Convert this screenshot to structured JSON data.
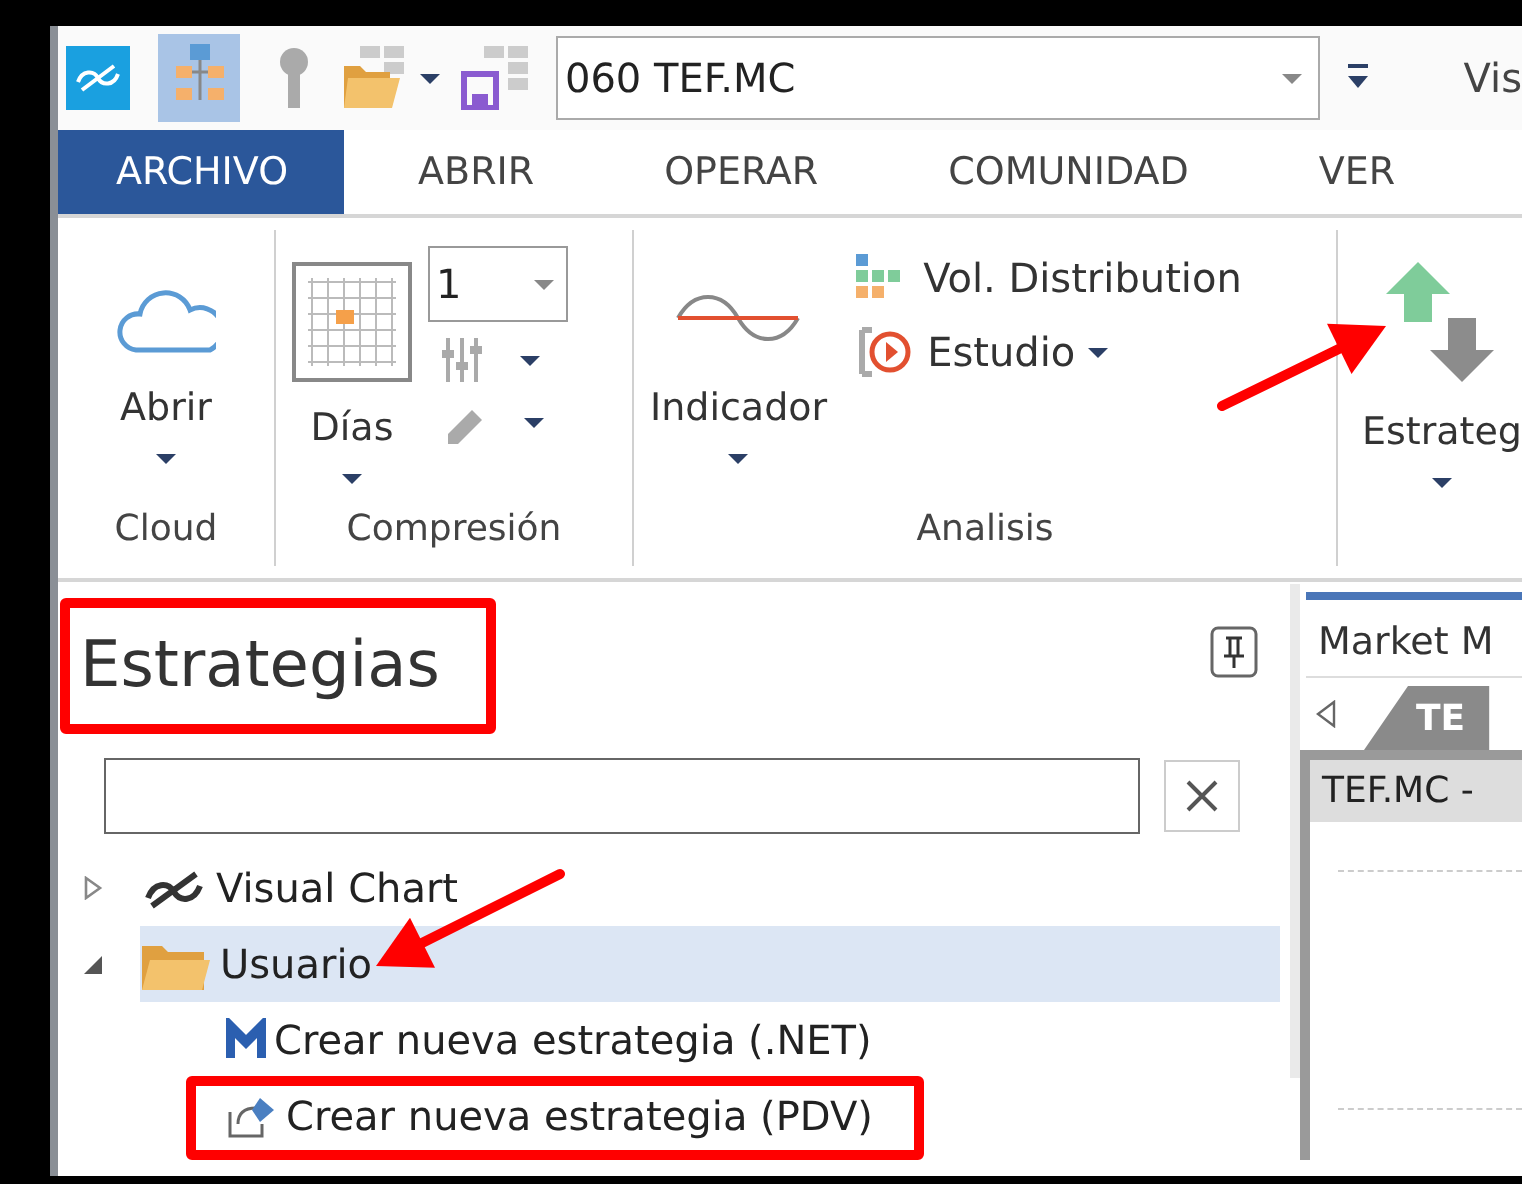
{
  "quick_access": {
    "symbol_field": {
      "value": "060 TEF.MC"
    },
    "app_title": "Vis"
  },
  "ribbon": {
    "tabs": [
      {
        "label": "ARCHIVO",
        "selected": true
      },
      {
        "label": "ABRIR",
        "selected": false
      },
      {
        "label": "OPERAR",
        "selected": false
      },
      {
        "label": "COMUNIDAD",
        "selected": false
      },
      {
        "label": "VER",
        "selected": false
      }
    ],
    "groups": [
      {
        "kind": "cloud",
        "label": "Cloud",
        "large_button": {
          "label": "Abrir"
        }
      },
      {
        "kind": "compression",
        "label": "Compresión",
        "large_button": {
          "label": "Días"
        },
        "spinner": {
          "value": "1"
        }
      },
      {
        "kind": "analysis",
        "label": "Analisis",
        "large_button": {
          "label": "Indicador"
        },
        "small_buttons": [
          {
            "label": "Vol. Distribution",
            "dropdown": false
          },
          {
            "label": "Estudio",
            "dropdown": true
          }
        ]
      },
      {
        "kind": "strategies",
        "large_button": {
          "label": "Estrateg",
          "arrow": true
        }
      }
    ]
  },
  "strategies_panel": {
    "title": "Estrategias",
    "title_highlighted": true,
    "tree": [
      {
        "kind": "logo",
        "label": "Visual Chart",
        "expanded": false,
        "selected": false
      },
      {
        "kind": "folder",
        "label": "Usuario",
        "expanded": true,
        "selected": true,
        "arrow": true,
        "children": [
          {
            "kind": "dotnet",
            "label": "Crear nueva estrategia (.NET)",
            "selected": false
          },
          {
            "kind": "script",
            "label": "Crear nueva estrategia (PDV)",
            "selected": false,
            "highlighted": true
          }
        ]
      }
    ]
  },
  "market_panel": {
    "title": "Market M",
    "tabs": [
      {
        "label": "TE",
        "selected": true
      }
    ],
    "chart_title": "TEF.MC -"
  }
}
